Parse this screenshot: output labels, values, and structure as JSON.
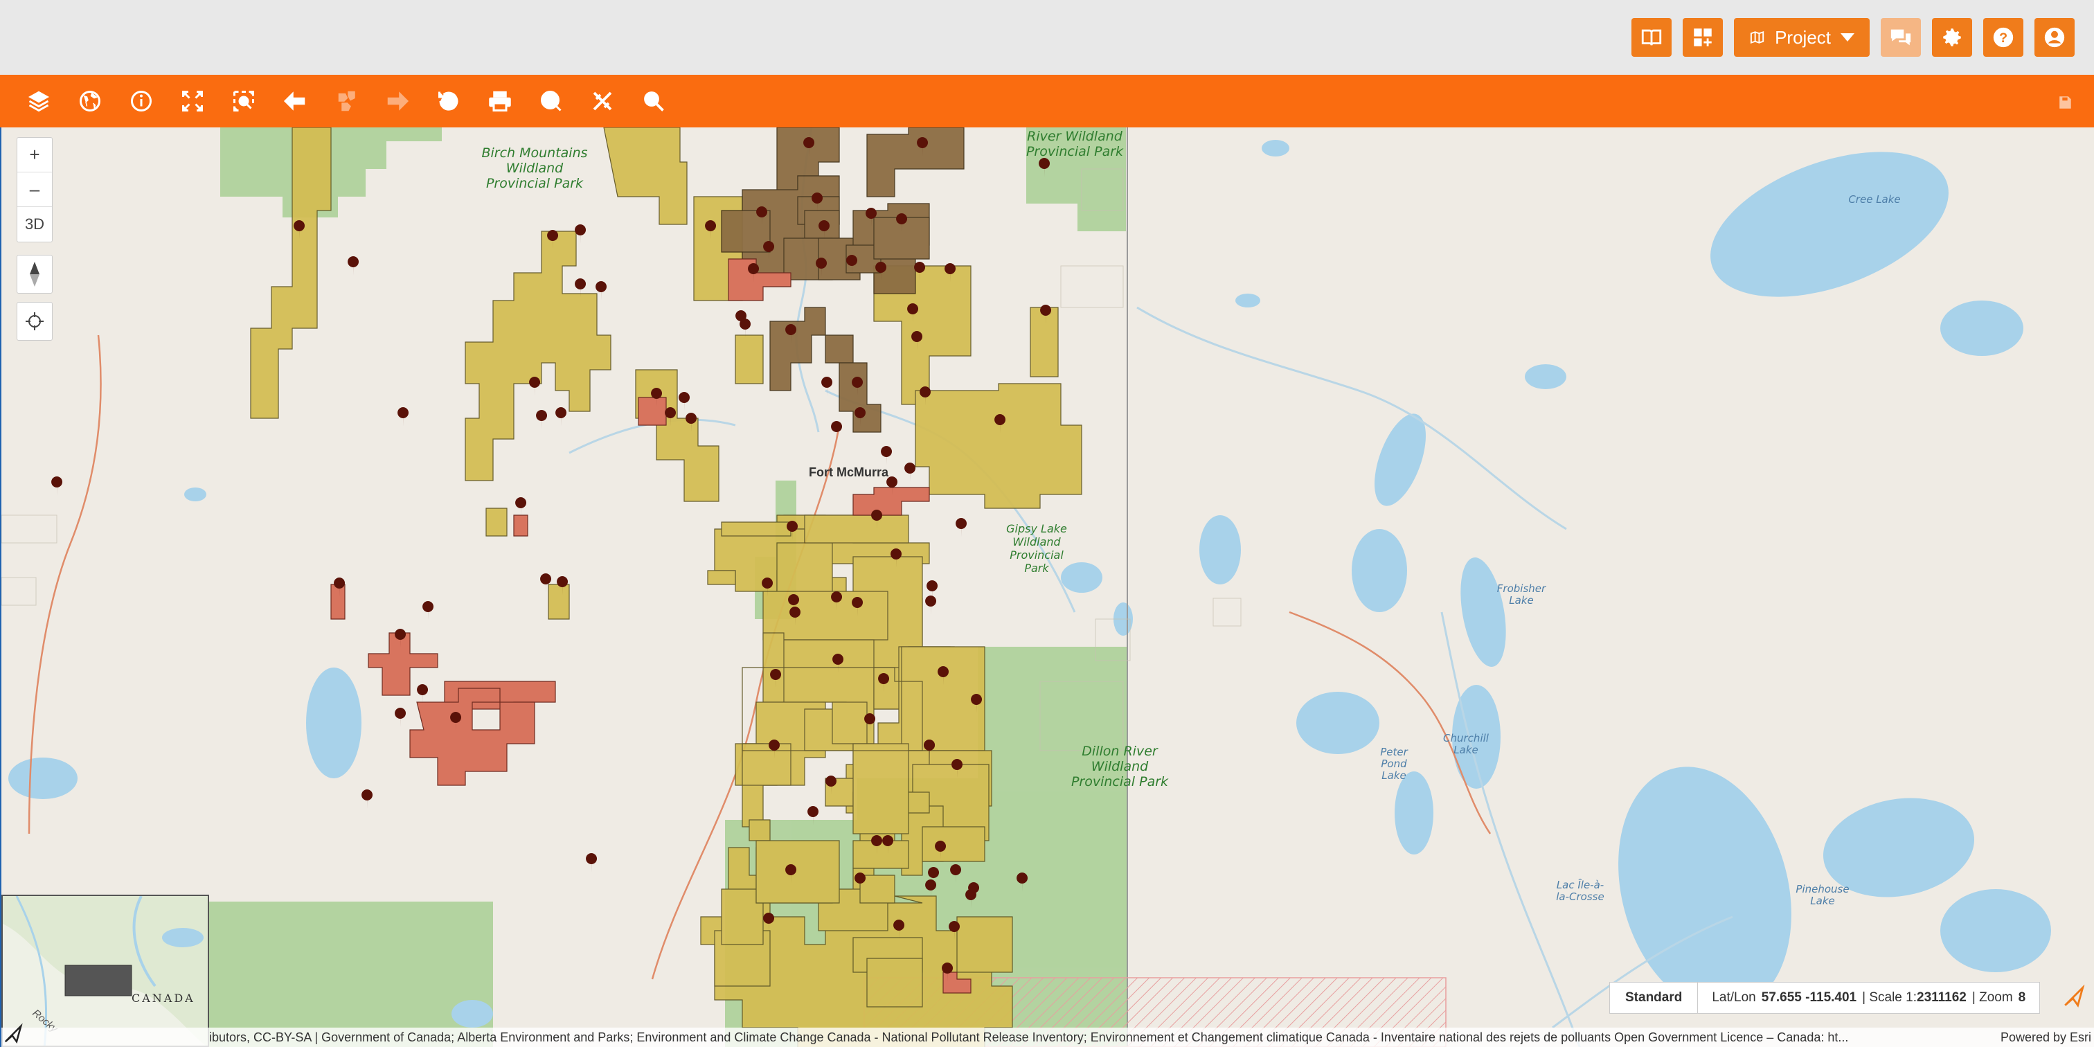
{
  "header": {
    "project_label": "Project",
    "buttons": [
      {
        "icon": "book-open-icon"
      },
      {
        "icon": "widgets-add-icon"
      },
      {
        "icon": "map-icon"
      },
      {
        "icon": "chat-icon"
      },
      {
        "icon": "gear-icon"
      },
      {
        "icon": "help-icon"
      },
      {
        "icon": "user-icon"
      }
    ]
  },
  "toolbar": {
    "tools": [
      "layers-icon",
      "basemap-globe-icon",
      "identify-info-icon",
      "full-extent-icon",
      "zoom-box-icon",
      "back-extent-icon",
      "select-features-icon",
      "forward-extent-icon",
      "history-icon",
      "print-icon",
      "analysis-icon",
      "draw-measure-icon",
      "search-icon"
    ],
    "save_icon": "save-icon"
  },
  "map": {
    "zoom_in": "+",
    "zoom_out": "–",
    "view_3d": "3D",
    "labels": {
      "birch": "Birch Mountains Wildland Provincial Park",
      "river": "River Wildland Provincial Park",
      "gipsy": "Gipsy Lake Wildland Provincial Park",
      "dillon": "Dillon River Wildland Provincial Park",
      "fort": "Fort McMurra",
      "cree": "Cree Lake",
      "frobisher": "Frobisher Lake",
      "churchill": "Churchill Lake",
      "peter": "Peter Pond Lake",
      "ile": "Lac Île-à-la-Crosse",
      "pinehouse": "Pinehouse Lake"
    },
    "overview_label": "CANADA",
    "overview_rocky": "Rocky"
  },
  "status": {
    "basemap": "Standard",
    "latlon_label": "Lat/Lon",
    "latlon_value": "57.655 -115.401",
    "scale_label": "| Scale 1:",
    "scale_value": "2311162",
    "zoom_label": "| Zoom",
    "zoom_value": "8"
  },
  "attribution": "ibutors, CC-BY-SA | Government of Canada; Alberta Environment and Parks; Environment and Climate Change Canada - National Pollutant Release Inventory; Environnement et Changement climatique Canada - Inventaire national des rejets de polluants Open Government Licence – Canada: ht...",
  "powered_by": "Powered by Esri",
  "colors": {
    "accent": "#fa6c10",
    "lease_yellow": "#d4bd52",
    "lease_brown": "#8c6d43",
    "lease_red": "#d8745e",
    "park_green": "#a8cf94",
    "water": "#a8d2ea",
    "marker": "#5a1208"
  }
}
